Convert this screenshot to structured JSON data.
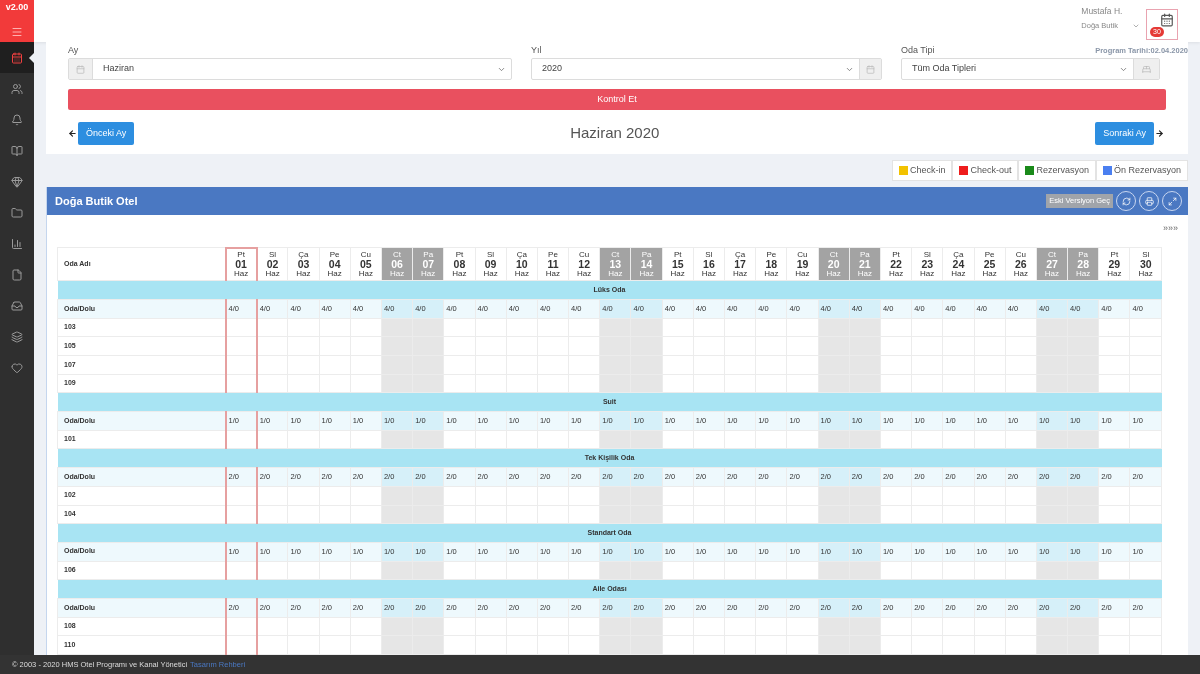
{
  "sidebar": {
    "version": "v2.00",
    "items": [
      {
        "selected": true
      },
      {
        "selected": false
      },
      {
        "selected": false
      },
      {
        "selected": false
      },
      {
        "selected": false
      },
      {
        "selected": false
      },
      {
        "selected": false
      },
      {
        "selected": false
      },
      {
        "selected": false
      },
      {
        "selected": false
      },
      {
        "selected": false
      }
    ]
  },
  "header": {
    "user_name": "Mustafa H.",
    "hotel": "Doğa Butik",
    "badge": "30",
    "program_date": "Program Tarihi:02.04.2020"
  },
  "filters": {
    "month": {
      "label": "Ay",
      "value": "Haziran"
    },
    "year": {
      "label": "Yıl",
      "value": "2020"
    },
    "room_type": {
      "label": "Oda Tipi",
      "value": "Tüm Oda Tipleri"
    },
    "check_button": "Kontrol Et"
  },
  "navigation": {
    "prev": "Önceki Ay",
    "title": "Haziran 2020",
    "next": "Sonraki Ay"
  },
  "legend": [
    {
      "label": "Check-in",
      "color": "#f2c200"
    },
    {
      "label": "Check-out",
      "color": "#ee1c1c"
    },
    {
      "label": "Rezervasyon",
      "color": "#1a8a1a"
    },
    {
      "label": "Ön Rezervasyon",
      "color": "#4a7ff0"
    }
  ],
  "panel": {
    "title": "Doğa Butik Otel",
    "old_version_button": "Eski Versiyon Geç",
    "more": "»»»"
  },
  "table": {
    "name_header": "Oda Adı",
    "days": [
      {
        "dow": "Pt",
        "day": "01",
        "month": "Haz",
        "weekend": false,
        "selected": true
      },
      {
        "dow": "Sl",
        "day": "02",
        "month": "Haz",
        "weekend": false,
        "selected": false
      },
      {
        "dow": "Ça",
        "day": "03",
        "month": "Haz",
        "weekend": false,
        "selected": false
      },
      {
        "dow": "Pe",
        "day": "04",
        "month": "Haz",
        "weekend": false,
        "selected": false
      },
      {
        "dow": "Cu",
        "day": "05",
        "month": "Haz",
        "weekend": false,
        "selected": false
      },
      {
        "dow": "Ct",
        "day": "06",
        "month": "Haz",
        "weekend": true,
        "selected": false
      },
      {
        "dow": "Pa",
        "day": "07",
        "month": "Haz",
        "weekend": true,
        "selected": false
      },
      {
        "dow": "Pt",
        "day": "08",
        "month": "Haz",
        "weekend": false,
        "selected": false
      },
      {
        "dow": "Sl",
        "day": "09",
        "month": "Haz",
        "weekend": false,
        "selected": false
      },
      {
        "dow": "Ça",
        "day": "10",
        "month": "Haz",
        "weekend": false,
        "selected": false
      },
      {
        "dow": "Pe",
        "day": "11",
        "month": "Haz",
        "weekend": false,
        "selected": false
      },
      {
        "dow": "Cu",
        "day": "12",
        "month": "Haz",
        "weekend": false,
        "selected": false
      },
      {
        "dow": "Ct",
        "day": "13",
        "month": "Haz",
        "weekend": true,
        "selected": false
      },
      {
        "dow": "Pa",
        "day": "14",
        "month": "Haz",
        "weekend": true,
        "selected": false
      },
      {
        "dow": "Pt",
        "day": "15",
        "month": "Haz",
        "weekend": false,
        "selected": false
      },
      {
        "dow": "Sl",
        "day": "16",
        "month": "Haz",
        "weekend": false,
        "selected": false
      },
      {
        "dow": "Ça",
        "day": "17",
        "month": "Haz",
        "weekend": false,
        "selected": false
      },
      {
        "dow": "Pe",
        "day": "18",
        "month": "Haz",
        "weekend": false,
        "selected": false
      },
      {
        "dow": "Cu",
        "day": "19",
        "month": "Haz",
        "weekend": false,
        "selected": false
      },
      {
        "dow": "Ct",
        "day": "20",
        "month": "Haz",
        "weekend": true,
        "selected": false
      },
      {
        "dow": "Pa",
        "day": "21",
        "month": "Haz",
        "weekend": true,
        "selected": false
      },
      {
        "dow": "Pt",
        "day": "22",
        "month": "Haz",
        "weekend": false,
        "selected": false
      },
      {
        "dow": "Sl",
        "day": "23",
        "month": "Haz",
        "weekend": false,
        "selected": false
      },
      {
        "dow": "Ça",
        "day": "24",
        "month": "Haz",
        "weekend": false,
        "selected": false
      },
      {
        "dow": "Pe",
        "day": "25",
        "month": "Haz",
        "weekend": false,
        "selected": false
      },
      {
        "dow": "Cu",
        "day": "26",
        "month": "Haz",
        "weekend": false,
        "selected": false
      },
      {
        "dow": "Ct",
        "day": "27",
        "month": "Haz",
        "weekend": true,
        "selected": false
      },
      {
        "dow": "Pa",
        "day": "28",
        "month": "Haz",
        "weekend": true,
        "selected": false
      },
      {
        "dow": "Pt",
        "day": "29",
        "month": "Haz",
        "weekend": false,
        "selected": false
      },
      {
        "dow": "Sl",
        "day": "30",
        "month": "Haz",
        "weekend": false,
        "selected": false
      }
    ],
    "sections": [
      {
        "name": "Lüks Oda",
        "summary_label": "Oda/Dolu",
        "summary": [
          "4/0",
          "4/0",
          "4/0",
          "4/0",
          "4/0",
          "4/0",
          "4/0",
          "4/0",
          "4/0",
          "4/0",
          "4/0",
          "4/0",
          "4/0",
          "4/0",
          "4/0",
          "4/0",
          "4/0",
          "4/0",
          "4/0",
          "4/0",
          "4/0",
          "4/0",
          "4/0",
          "4/0",
          "4/0",
          "4/0",
          "4/0",
          "4/0",
          "4/0",
          "4/0"
        ],
        "rooms": [
          "103",
          "105",
          "107",
          "109"
        ]
      },
      {
        "name": "Suit",
        "summary_label": "Oda/Dolu",
        "summary": [
          "1/0",
          "1/0",
          "1/0",
          "1/0",
          "1/0",
          "1/0",
          "1/0",
          "1/0",
          "1/0",
          "1/0",
          "1/0",
          "1/0",
          "1/0",
          "1/0",
          "1/0",
          "1/0",
          "1/0",
          "1/0",
          "1/0",
          "1/0",
          "1/0",
          "1/0",
          "1/0",
          "1/0",
          "1/0",
          "1/0",
          "1/0",
          "1/0",
          "1/0",
          "1/0"
        ],
        "rooms": [
          "101"
        ]
      },
      {
        "name": "Tek Kişilik Oda",
        "summary_label": "Oda/Dolu",
        "summary": [
          "2/0",
          "2/0",
          "2/0",
          "2/0",
          "2/0",
          "2/0",
          "2/0",
          "2/0",
          "2/0",
          "2/0",
          "2/0",
          "2/0",
          "2/0",
          "2/0",
          "2/0",
          "2/0",
          "2/0",
          "2/0",
          "2/0",
          "2/0",
          "2/0",
          "2/0",
          "2/0",
          "2/0",
          "2/0",
          "2/0",
          "2/0",
          "2/0",
          "2/0",
          "2/0"
        ],
        "rooms": [
          "102",
          "104"
        ]
      },
      {
        "name": "Standart Oda",
        "summary_label": "Oda/Dolu",
        "summary": [
          "1/0",
          "1/0",
          "1/0",
          "1/0",
          "1/0",
          "1/0",
          "1/0",
          "1/0",
          "1/0",
          "1/0",
          "1/0",
          "1/0",
          "1/0",
          "1/0",
          "1/0",
          "1/0",
          "1/0",
          "1/0",
          "1/0",
          "1/0",
          "1/0",
          "1/0",
          "1/0",
          "1/0",
          "1/0",
          "1/0",
          "1/0",
          "1/0",
          "1/0",
          "1/0"
        ],
        "rooms": [
          "106"
        ]
      },
      {
        "name": "Aile Odası",
        "summary_label": "Oda/Dolu",
        "summary": [
          "2/0",
          "2/0",
          "2/0",
          "2/0",
          "2/0",
          "2/0",
          "2/0",
          "2/0",
          "2/0",
          "2/0",
          "2/0",
          "2/0",
          "2/0",
          "2/0",
          "2/0",
          "2/0",
          "2/0",
          "2/0",
          "2/0",
          "2/0",
          "2/0",
          "2/0",
          "2/0",
          "2/0",
          "2/0",
          "2/0",
          "2/0",
          "2/0",
          "2/0",
          "2/0"
        ],
        "rooms": [
          "108",
          "110"
        ]
      }
    ]
  },
  "footer": {
    "copyright": "© 2003 - 2020 HMS Otel Programı ve Kanal Yönetici",
    "link": "Tasarım Rehberi"
  }
}
